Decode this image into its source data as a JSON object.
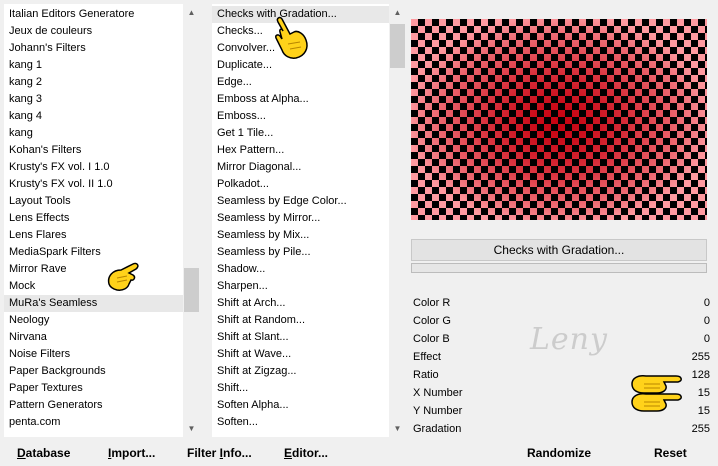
{
  "categories": {
    "items": [
      "Italian Editors Generatore",
      "Jeux de couleurs",
      "Johann's Filters",
      "kang 1",
      "kang 2",
      "kang 3",
      "kang 4",
      "kang",
      "Kohan's Filters",
      "Krusty's FX vol. I 1.0",
      "Krusty's FX vol. II 1.0",
      "Layout Tools",
      "Lens Effects",
      "Lens Flares",
      "MediaSpark Filters",
      "Mirror Rave",
      "Mock",
      "MuRa's Seamless",
      "Neology",
      "Nirvana",
      "Noise Filters",
      "Paper Backgrounds",
      "Paper Textures",
      "Pattern Generators",
      "penta.com"
    ],
    "selected_index": 17
  },
  "filters": {
    "items": [
      "Checks with Gradation...",
      "Checks...",
      "Convolver...",
      "Duplicate...",
      "Edge...",
      "Emboss at Alpha...",
      "Emboss...",
      "Get 1 Tile...",
      "Hex Pattern...",
      "Mirror Diagonal...",
      "Polkadot...",
      "Seamless by Edge Color...",
      "Seamless by Mirror...",
      "Seamless by Mix...",
      "Seamless by Pile...",
      "Shadow...",
      "Sharpen...",
      "Shift at Arch...",
      "Shift at Random...",
      "Shift at Slant...",
      "Shift at Wave...",
      "Shift at Zigzag...",
      "Shift...",
      "Soften Alpha...",
      "Soften..."
    ],
    "selected_index": 0
  },
  "preview": {
    "filter_name": "Checks with Gradation...",
    "check_color": "#000000",
    "base_color": "#ff9aa0",
    "center_color": "#c8000f"
  },
  "params": [
    {
      "label": "Color R",
      "value": "0"
    },
    {
      "label": "Color G",
      "value": "0"
    },
    {
      "label": "Color B",
      "value": "0"
    },
    {
      "label": "Effect",
      "value": "255"
    },
    {
      "label": "Ratio",
      "value": "128"
    },
    {
      "label": "X Number",
      "value": "15"
    },
    {
      "label": "Y Number",
      "value": "15"
    },
    {
      "label": "Gradation",
      "value": "255"
    }
  ],
  "watermark": "Leny",
  "buttons": {
    "database": {
      "first": "D",
      "rest": "atabase"
    },
    "import": {
      "first": "I",
      "rest": "mport..."
    },
    "filter_info": {
      "first": "Filter ",
      "u": "I",
      "rest": "nfo..."
    },
    "editor": {
      "first": "E",
      "rest": "ditor..."
    },
    "randomize": "Randomize",
    "reset": "Reset"
  },
  "icons": {
    "scroll_up": "scroll-up-arrow-icon",
    "scroll_down": "scroll-down-arrow-icon",
    "hand": "pointing-hand-icon"
  }
}
